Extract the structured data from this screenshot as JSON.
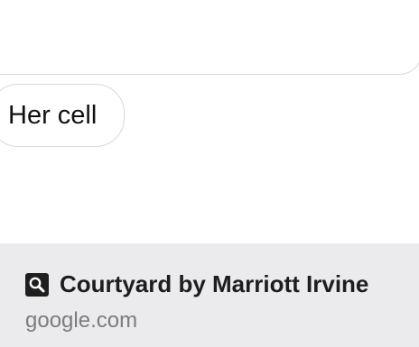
{
  "messages": [
    {
      "text": ""
    },
    {
      "text": "Her cell"
    }
  ],
  "link_preview": {
    "icon": "search-icon",
    "title": "Courtyard by Marriott Irvine",
    "domain": "google.com"
  },
  "colors": {
    "bubble_border": "#d9d9d9",
    "preview_background": "#ebebed",
    "domain_text": "#7b7b80"
  }
}
